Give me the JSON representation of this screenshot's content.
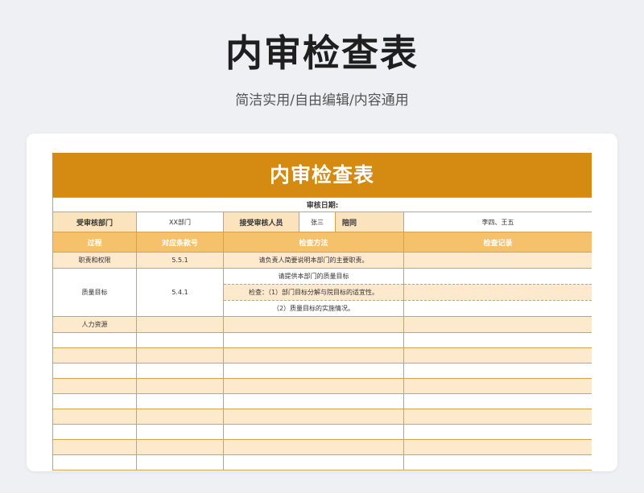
{
  "hero": {
    "title": "内审检查表",
    "subtitle": "简洁实用/自由编辑/内容通用"
  },
  "sheet": {
    "banner_title": "内审检查表",
    "audit_date_label": "审核日期:",
    "info": {
      "audited_dept_label": "受审核部门",
      "audited_dept_value": "XX部门",
      "auditee_label": "接受审核人员",
      "auditee_value": "张三",
      "accompany_label": "陪同",
      "accompany_value": "李四、王五"
    },
    "headers": [
      "过程",
      "对应条款号",
      "检查方法",
      "检查记录"
    ],
    "rows": [
      {
        "process": "职责和权限",
        "clause": "5.5.1",
        "methods": [
          "请负责人简要说明本部门的主要职责。"
        ],
        "record": ""
      },
      {
        "process": "质量目标",
        "clause": "5.4.1",
        "methods": [
          "请提供本部门的质量目标",
          "检查：（1）部门目标分解与院目标的适宜性。",
          "（2）质量目标的实施情况。"
        ],
        "record": ""
      },
      {
        "process": "人力资源",
        "clause": "",
        "methods": [
          ""
        ],
        "record": ""
      }
    ],
    "empty_row_count": 9
  },
  "colors": {
    "banner": "#d58b12",
    "header": "#f5c16b",
    "label_fill": "#fbe3bd",
    "stripe": "#fde9cc",
    "border": "#d9a24a"
  }
}
